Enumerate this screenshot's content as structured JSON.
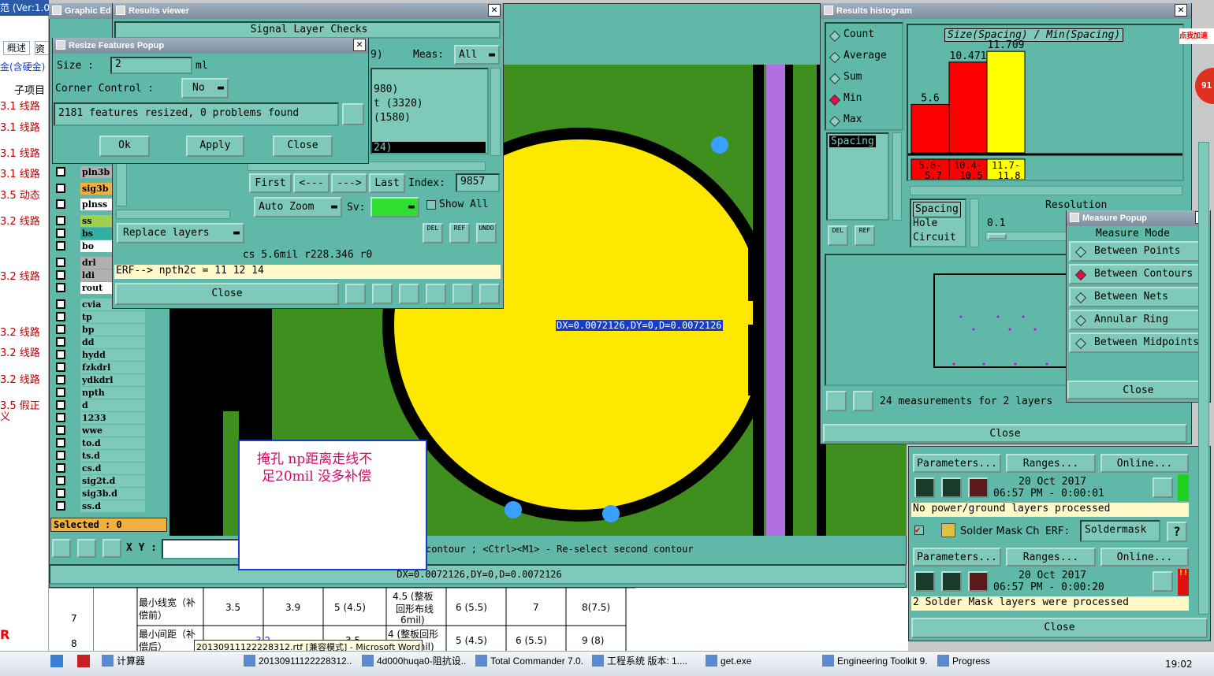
{
  "colors": {
    "teal": "#5fb8a8",
    "canvas_green": "#3f8f1f",
    "pad_yellow": "#ffe800",
    "violet": "#b070e0",
    "blue_dot": "#3aa0ff"
  },
  "left_doc": {
    "title_fragment": "范 (Ver:1.0",
    "tabs": [
      "概述",
      "资"
    ],
    "link_line": "金(含硬金)",
    "header": "子项目",
    "rows": [
      "3.1 线路",
      "3.1 线路",
      "3.1 线路",
      "3.1 线路",
      "3.5 动态",
      "3.2 线路",
      "3.2 线路",
      "3.2 线路",
      "3.2 线路",
      "3.2 线路",
      "3.5 假正",
      "义"
    ]
  },
  "graphic_editor": {
    "title": "Graphic Ed",
    "layers": [
      "pln3b",
      "sig3b",
      "plnss",
      "ss",
      "bs",
      "bo",
      "drl",
      "ldi",
      "rout",
      "cvia",
      "tp",
      "bp",
      "dd",
      "hydd",
      "fzkdrl",
      "ydkdrl",
      "npth",
      "d",
      "1233",
      "wwe",
      "to.d",
      "ts.d",
      "cs.d",
      "sig2t.d",
      "sig3b.d",
      "ss.d"
    ],
    "selected": "Selected : 0",
    "xy_label": "X Y :",
    "status_line": "contour ; <Ctrl><M1> - Re-select second contour",
    "readout": "DX=0.0072126,DY=0,D=0.0072126",
    "canvas_readout": "DX=0.0072126,DY=0,D=0.0072126"
  },
  "results_viewer": {
    "title": "Results viewer",
    "heading": "Signal Layer Checks",
    "meas_label": "Meas:",
    "meas_value": "All",
    "partial_1": "9)",
    "list_items": [
      "980)",
      "t (3320)",
      "(1580)",
      "24)"
    ],
    "nav": [
      "First",
      "<---",
      "--->",
      "Last"
    ],
    "index_label": "Index:",
    "index_value": "9857",
    "auto_zoom": "Auto Zoom",
    "sv_label": "Sv:",
    "show_all": "Show All",
    "replace_layers": "Replace layers",
    "info": "cs 5.6mil  r228.346  r0",
    "erf": "ERF--> npth2c = 11 12 14",
    "close": "Close",
    "icon_labels": [
      "DEL",
      "REF",
      "UNDO"
    ]
  },
  "resize_popup": {
    "title": "Resize Features Popup",
    "size_label": "Size :",
    "size_value": "2",
    "size_unit": "ml",
    "corner_label": "Corner Control :",
    "corner_value": "No",
    "message": "2181 features resized, 0 problems found",
    "ok": "Ok",
    "apply": "Apply",
    "close": "Close"
  },
  "histogram": {
    "title": "Results histogram",
    "modes": [
      "Count",
      "Average",
      "Sum",
      "Min",
      "Max"
    ],
    "selected_mode": "Min",
    "chart_title": "Size(Spacing) / Min(Spacing)",
    "list": [
      "Spacing"
    ],
    "list2": [
      "Spacing",
      "Hole",
      "Circuit"
    ],
    "resolution_label": "Resolution",
    "resolution_value": "0.1",
    "measurements": "24 measurements for 2 layers",
    "close": "Close",
    "icon_labels": [
      "DEL",
      "REF"
    ]
  },
  "chart_data": {
    "type": "bar",
    "title": "Size(Spacing) / Min(Spacing)",
    "categories": [
      "5.6-5.7",
      "10.4-10.5",
      "11.7-11.8"
    ],
    "values": [
      5.6,
      10.471,
      11.709
    ],
    "value_labels": [
      "5.6",
      "10.471",
      "11.709"
    ],
    "colors": [
      "#ff0000",
      "#ff0000",
      "#ffff00"
    ],
    "ylim": [
      0,
      12
    ]
  },
  "measure_popup": {
    "title": "Measure Popup",
    "heading": "Measure Mode",
    "options": [
      "Between Points",
      "Between Contours",
      "Between Nets",
      "Annular Ring",
      "Between Midpoints"
    ],
    "selected": "Between Contours",
    "close": "Close"
  },
  "lower_panel": {
    "params": "Parameters...",
    "ranges": "Ranges...",
    "online": "Online...",
    "date1": "20 Oct 2017",
    "time1": "06:57 PM - 0:00:01",
    "msg1": "No power/ground layers processed",
    "solder_label": "Solder Mask Ch",
    "erf_label": "ERF:",
    "erf_value": "Soldermask",
    "date2": "20 Oct 2017",
    "time2": "06:57 PM - 0:00:20",
    "msg2": "2 Solder Mask layers were processed",
    "close": "Close"
  },
  "annotation": {
    "line1": "掩孔 np距离走线不",
    "line2": "足20mil 没多补偿"
  },
  "table": {
    "rownums": [
      "7",
      "8"
    ],
    "r1": [
      "最小线宽（补",
      "偿前）",
      "3.5",
      "3.9",
      "5 (4.5)",
      "4.5 (整板",
      "回形布线",
      "6mil)",
      "6 (5.5)",
      "7",
      "8(7.5)"
    ],
    "r2": [
      "最小间距（补",
      "偿后）",
      "3.2",
      "3.5",
      "4 (整板回形",
      "线6mil)",
      "5 (4.5)",
      "6 (5.5)",
      "9 (8)"
    ]
  },
  "tooltip": "20130911122228312.rtf [兼容模式] - Microsoft Word",
  "badge": {
    "text": "点我加速",
    "count": "91"
  },
  "taskbar": {
    "items": [
      "计算器",
      "20130911122228312...",
      "4d000huqa0-阻抗设...",
      "Total Commander 7.0...",
      "工程系统  版本: 1....",
      "get.exe",
      "Engineering Toolkit 9....",
      "Progress"
    ],
    "clock": "19:02"
  }
}
